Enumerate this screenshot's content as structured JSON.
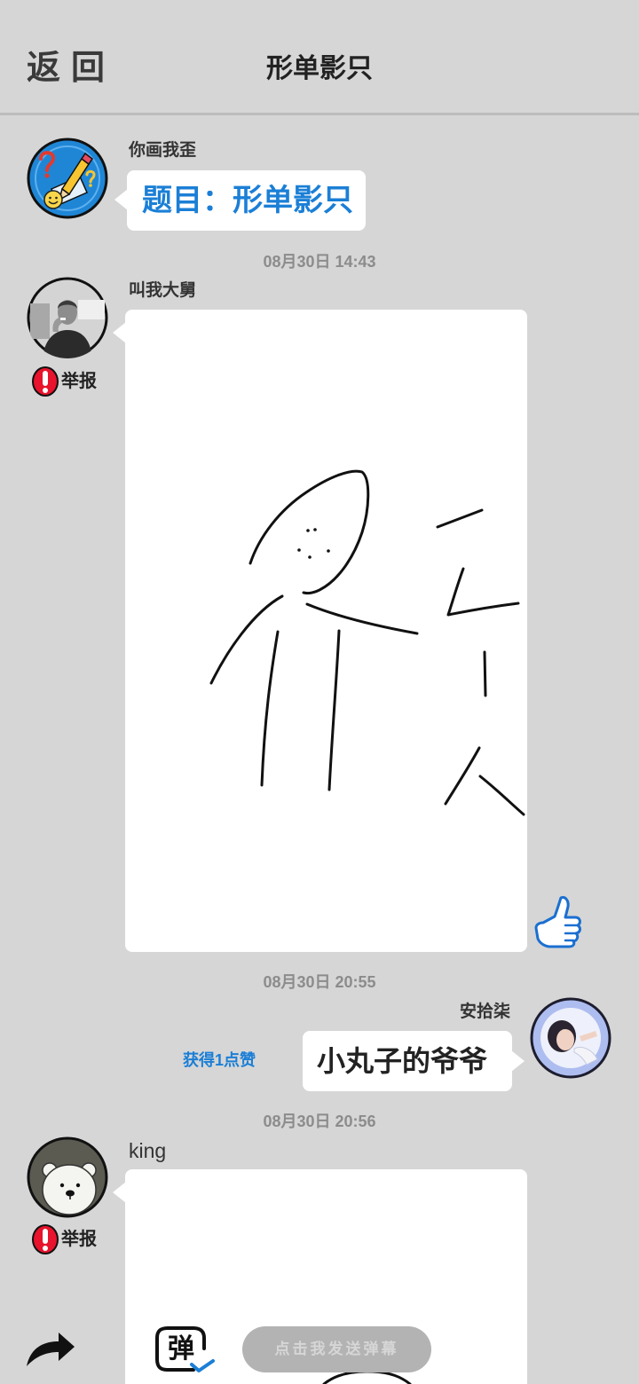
{
  "colors": {
    "background": "#d6d6d6",
    "accent_blue": "#1b7fd6",
    "report_red": "#e8132c",
    "text_dark": "#222222",
    "timestamp_gray": "#8c8c8c",
    "input_gray": "#b3b3b3"
  },
  "header": {
    "back_label": "返回",
    "title": "形单影只"
  },
  "topic_message": {
    "sender": "你画我歪",
    "avatar_icon": "pencil-logo-avatar",
    "text": "题目：形单影只"
  },
  "timestamps": [
    "08月30日 14:43",
    "08月30日 20:55",
    "08月30日 20:56"
  ],
  "drawing_messages": [
    {
      "sender": "叫我大舅",
      "avatar_icon": "man-photo-avatar",
      "report_icon": "exclamation-icon",
      "report_label": "举报",
      "like_icon": "thumbs-up-icon"
    },
    {
      "sender": "king",
      "avatar_icon": "ice-bear-avatar",
      "report_icon": "exclamation-icon",
      "report_label": "举报"
    }
  ],
  "guess_message": {
    "sender": "安拾柒",
    "avatar_icon": "girl-photo-avatar",
    "text": "小丸子的爷爷",
    "likes_label": "获得1点赞"
  },
  "bottom_bar": {
    "share_icon": "share-arrow-icon",
    "danmaku_icon": "danmaku-icon",
    "danmaku_icon_label": "弹",
    "danmaku_input_label": "点击我发送弹幕"
  }
}
